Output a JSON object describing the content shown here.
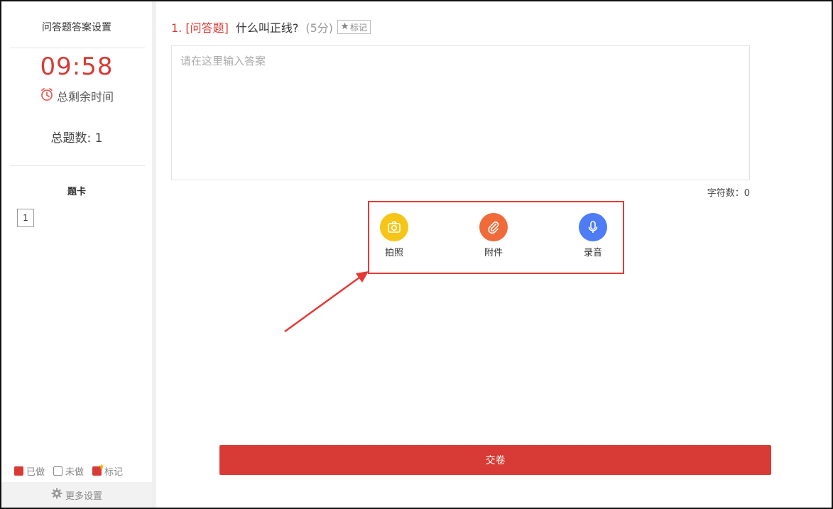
{
  "sidebar": {
    "title": "问答题答案设置",
    "timer": "09:58",
    "remaining_label": "总剩余时间",
    "total_questions": "总题数: 1",
    "card_title": "题卡",
    "question_numbers": [
      "1"
    ],
    "legend": {
      "done": "已做",
      "undone": "未做",
      "marked": "标记"
    },
    "more_settings": "更多设置"
  },
  "question": {
    "number": "1. [问答题]",
    "text": "什么叫正线?",
    "score": "(5分)",
    "mark_label": "标记",
    "answer_placeholder": "请在这里输入答案",
    "char_count": "字符数：0"
  },
  "tools": {
    "photo": {
      "label": "拍照",
      "icon": "camera-icon",
      "color": "#f5c518"
    },
    "attachment": {
      "label": "附件",
      "icon": "paperclip-icon",
      "color": "#f06a3a"
    },
    "record": {
      "label": "录音",
      "icon": "microphone-icon",
      "color": "#4d7cf4"
    }
  },
  "submit_label": "交卷",
  "colors": {
    "accent": "#d83b35",
    "highlight_border": "#e53935"
  }
}
